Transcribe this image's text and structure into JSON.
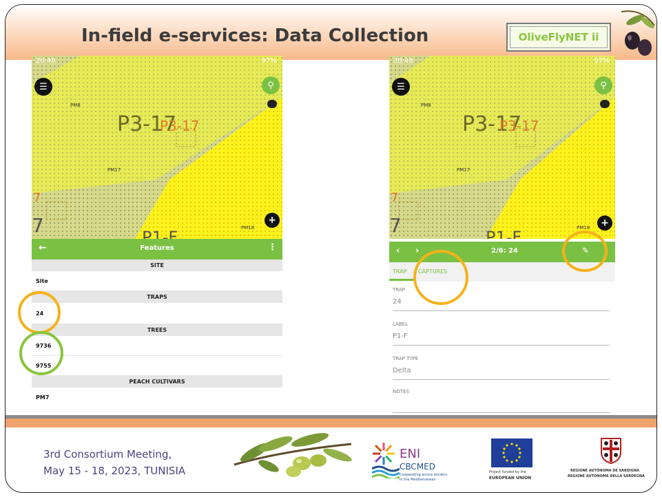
{
  "slide": {
    "title": "In-field e-services: Data Collection",
    "brand": "OliveFlyNET ii"
  },
  "left_phone": {
    "status_time": "20:48",
    "status_right": "97%",
    "map_labels": {
      "block_main": "P3-17",
      "block_overlap": "P3-17",
      "pm8": "PM8",
      "pm17": "PM17",
      "pm18": "PM18",
      "edge_num": "7",
      "edge_big": "7",
      "bottom_block": "P1-F"
    },
    "appbar_title": "Features",
    "sections": [
      {
        "header": "SITE",
        "rows": [
          "Site"
        ]
      },
      {
        "header": "TRAPS",
        "rows": [
          "24"
        ]
      },
      {
        "header": "TREES",
        "rows": [
          "9736",
          "9755"
        ]
      },
      {
        "header": "PEACH CULTIVARS",
        "rows": [
          "PM7"
        ]
      }
    ]
  },
  "right_phone": {
    "status_time": "20:48",
    "status_right": "97%",
    "map_labels": {
      "block_main": "P3-17",
      "block_overlap": "P3-17",
      "pm8": "PM8",
      "pm17": "PM17",
      "pm18": "PM18",
      "edge_num": "7",
      "edge_big": "7",
      "bottom_block": "P1-F"
    },
    "appbar_title": "2/6: 24",
    "tabs": [
      "TRAP",
      "CAPTURES"
    ],
    "fields": [
      {
        "label": "TRAP",
        "value": "24"
      },
      {
        "label": "LABEL",
        "value": "P1-F"
      },
      {
        "label": "TRAP TYPE",
        "value": "Delta"
      },
      {
        "label": "NOTES",
        "value": ""
      }
    ]
  },
  "footer": {
    "meeting_line1": "3rd Consortium Meeting,",
    "meeting_line2": "May 15 - 18, 2023, TUNISIA",
    "eni": "ENI",
    "cbcmed": "CBCMED",
    "cbcmed_sub1": "Cooperating across borders",
    "cbcmed_sub2": "in the Mediterranean",
    "eu_line1": "Project funded by the",
    "eu_line2": "EUROPEAN UNION",
    "sardegna_line1": "REGIONE AUTÒNOMA DE SARDIGNA",
    "sardegna_line2": "REGIONE AUTONOMA DELLA SARDEGNA"
  },
  "colors": {
    "app_green": "#7ac143",
    "highlight_orange": "#f5a623",
    "highlight_green": "#8ac53e",
    "footer_text": "#4a4280"
  }
}
